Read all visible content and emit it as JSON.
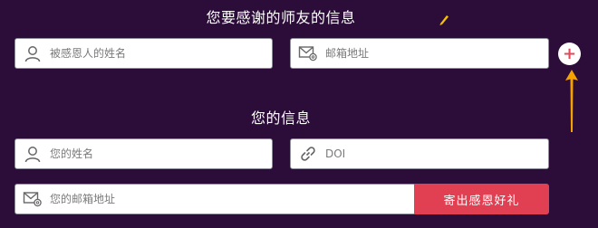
{
  "thanked_section": {
    "title": "您要感谢的师友的信息",
    "name_placeholder": "被感恩人的姓名",
    "email_placeholder": "邮箱地址",
    "add_button_label": "+"
  },
  "your_section": {
    "title": "您的信息",
    "name_placeholder": "您的姓名",
    "doi_placeholder": "DOI",
    "email_placeholder": "您的邮箱地址",
    "submit_label": "寄出感恩好礼"
  },
  "icons": {
    "person": "user-icon",
    "mail": "mail-icon",
    "link": "link-icon",
    "plus": "plus-icon",
    "annotation": "arrow-annotation"
  },
  "colors": {
    "background": "#2c0c39",
    "accent": "#e04052",
    "annotation": "#f5a200"
  }
}
